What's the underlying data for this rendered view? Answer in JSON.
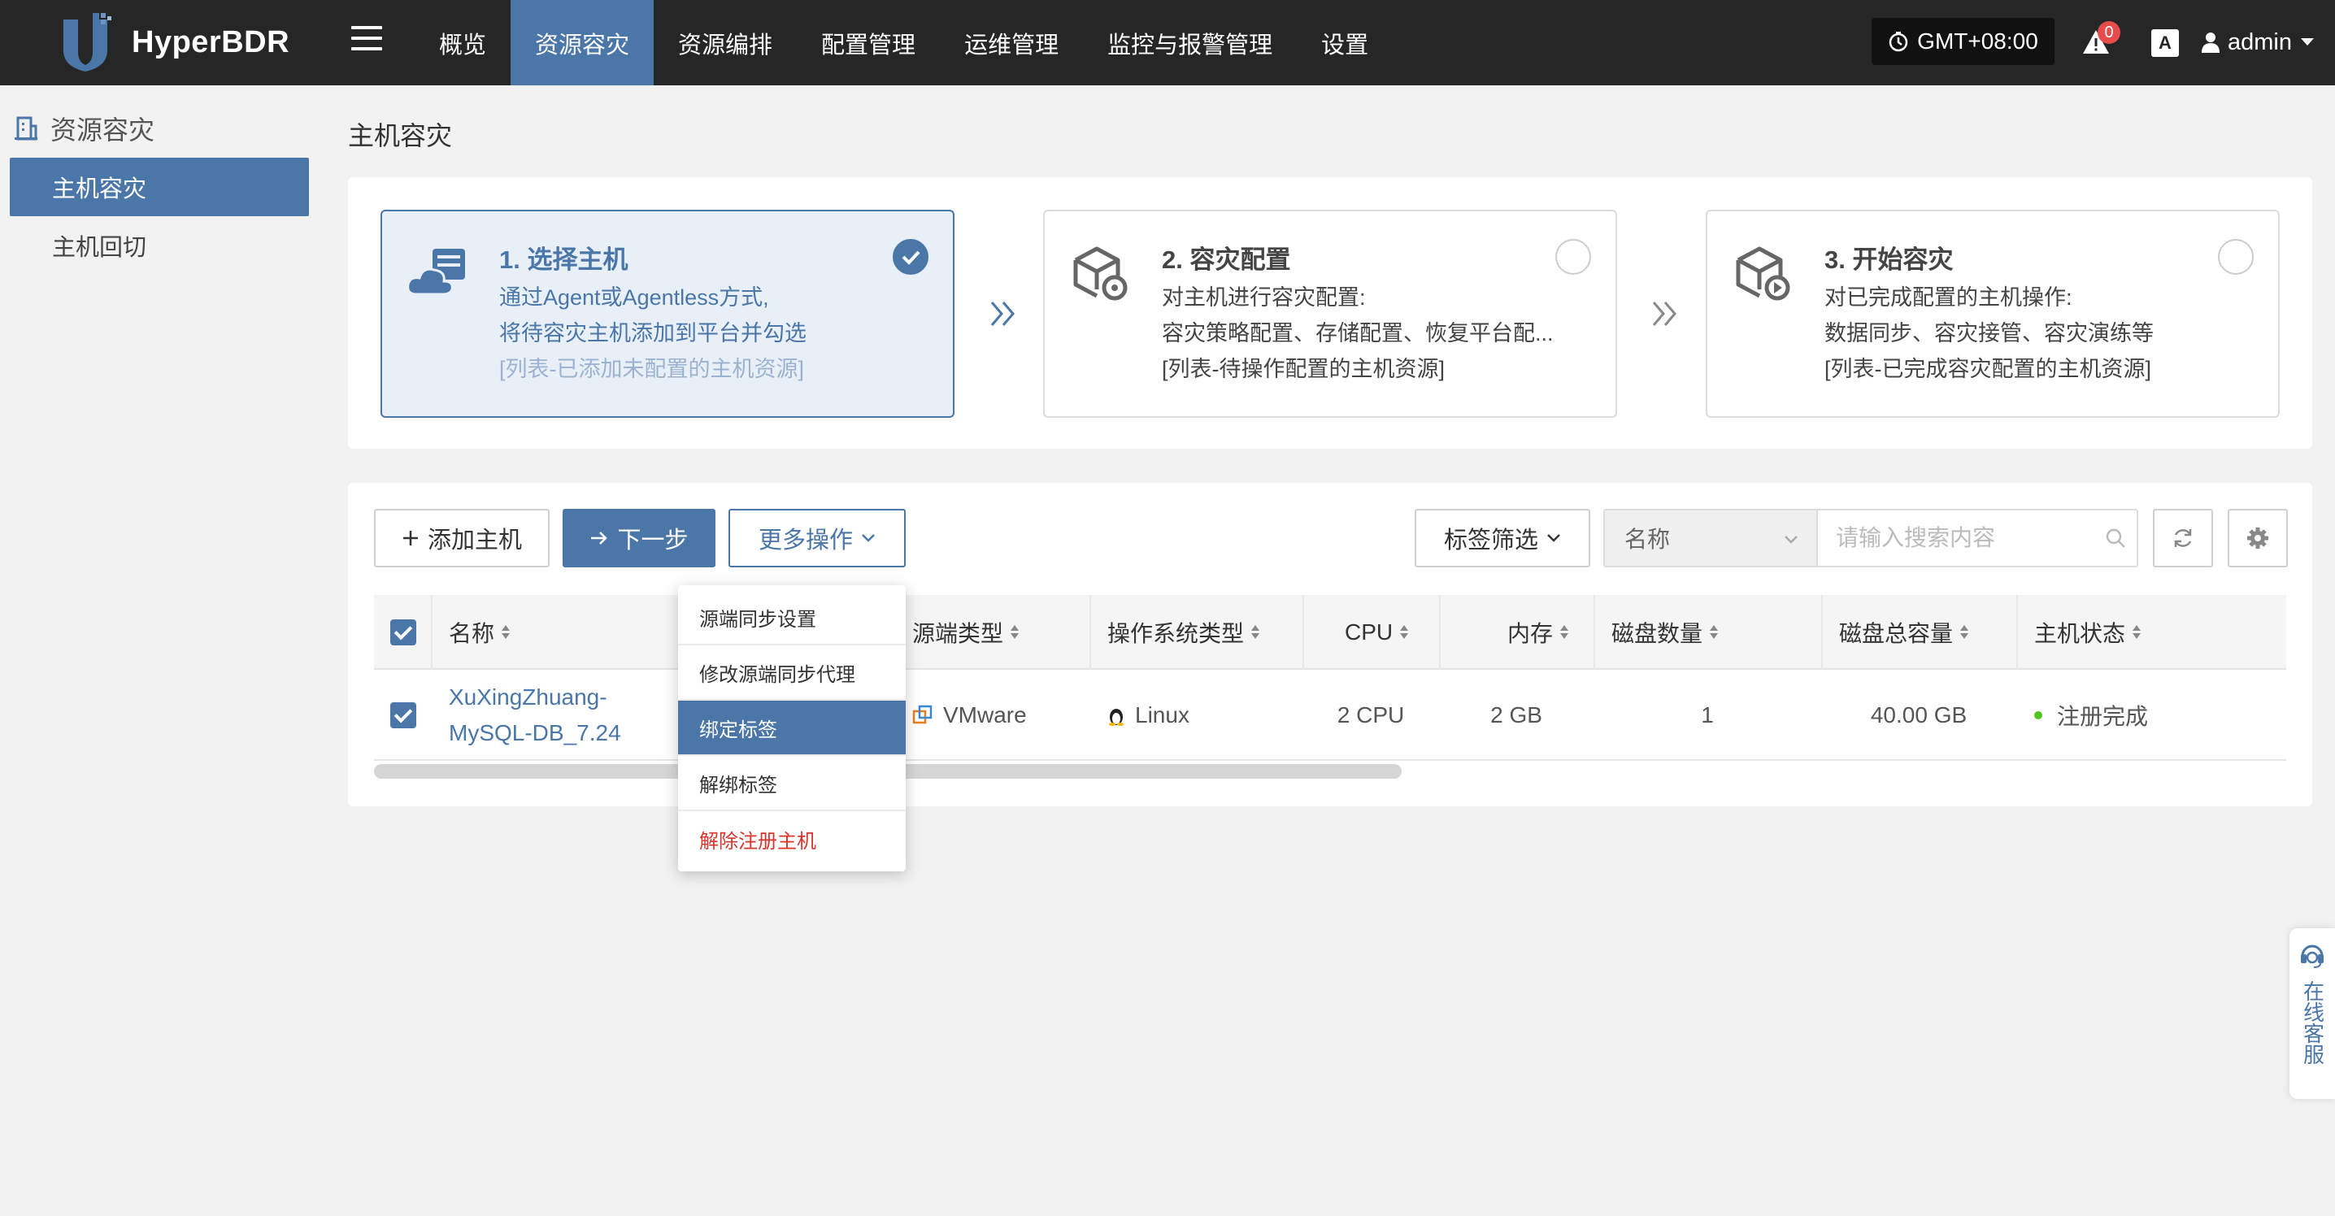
{
  "header": {
    "app_name": "HyperBDR",
    "nav": [
      "概览",
      "资源容灾",
      "资源编排",
      "配置管理",
      "运维管理",
      "监控与报警管理",
      "设置"
    ],
    "active_nav": "资源容灾",
    "timezone": "GMT+08:00",
    "alert_count": "0",
    "translate_label": "A",
    "username": "admin"
  },
  "sidebar": {
    "title": "资源容灾",
    "items": [
      {
        "label": "主机容灾",
        "active": true
      },
      {
        "label": "主机回切",
        "active": false
      }
    ]
  },
  "main": {
    "page_title": "主机容灾",
    "steps": [
      {
        "title": "1. 选择主机",
        "line1": "通过Agent或Agentless方式,",
        "line2": "将待容灾主机添加到平台并勾选",
        "line3": "[列表-已添加未配置的主机资源]",
        "checked": true
      },
      {
        "title": "2. 容灾配置",
        "line1": "对主机进行容灾配置:",
        "line2": "容灾策略配置、存储配置、恢复平台配...",
        "line3": "[列表-待操作配置的主机资源]",
        "checked": false
      },
      {
        "title": "3. 开始容灾",
        "line1": "对已完成配置的主机操作:",
        "line2": "数据同步、容灾接管、容灾演练等",
        "line3": "[列表-已完成容灾配置的主机资源]",
        "checked": false
      }
    ],
    "toolbar": {
      "add_host": "添加主机",
      "next_step": "下一步",
      "more_actions": "更多操作",
      "tag_filter": "标签筛选",
      "search_field": "名称",
      "search_placeholder": "请输入搜索内容"
    },
    "table": {
      "columns": [
        "名称",
        "源端类型",
        "操作系统类型",
        "CPU",
        "内存",
        "磁盘数量",
        "磁盘总容量",
        "主机状态"
      ],
      "rows": [
        {
          "name_line1": "XuXingZhuang-",
          "name_line2": "MySQL-DB_7.24",
          "source_type": "VMware",
          "os_type": "Linux",
          "cpu": "2 CPU",
          "memory": "2 GB",
          "disk_count": "1",
          "disk_total": "40.00 GB",
          "status": "注册完成"
        }
      ]
    },
    "more_actions_menu": [
      "源端同步设置",
      "修改源端同步代理",
      "绑定标签",
      "解绑标签",
      "解除注册主机"
    ],
    "menu_highlighted": "绑定标签"
  },
  "support": {
    "label": "在线客服"
  },
  "colors": {
    "primary": "#4a76a8",
    "topbar": "#262626",
    "danger": "#d9342b",
    "success": "#52c41a"
  }
}
